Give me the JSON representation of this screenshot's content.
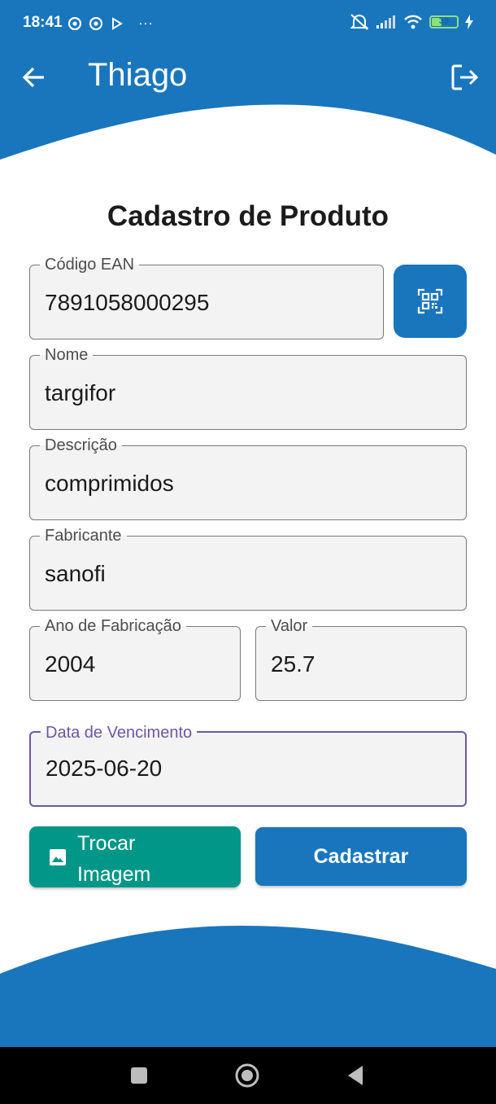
{
  "status_bar": {
    "time": "18:41",
    "more_dots": "···",
    "battery_level": "39",
    "left_icons": [
      "chrome-icon",
      "chrome-icon",
      "play-icon"
    ],
    "right_icons": [
      "mute-icon",
      "signal-icon",
      "wifi-icon",
      "battery-icon",
      "charging-icon"
    ]
  },
  "app_bar": {
    "title": "Thiago",
    "back_icon": "arrow-left-icon",
    "logout_icon": "logout-icon",
    "color": "#1976bd"
  },
  "form": {
    "title": "Cadastro de Produto",
    "ean": {
      "label": "Código EAN",
      "value": "7891058000295"
    },
    "nome": {
      "label": "Nome",
      "value": "targifor"
    },
    "descricao": {
      "label": "Descrição",
      "value": "comprimidos"
    },
    "fabricante": {
      "label": "Fabricante",
      "value": "sanofi"
    },
    "ano": {
      "label": "Ano de Fabricação",
      "value": "2004"
    },
    "valor": {
      "label": "Valor",
      "value": "25.7"
    },
    "vencimento": {
      "label": "Data de Vencimento",
      "value": "2025-06-20"
    },
    "scan_icon": "qr-scan-icon"
  },
  "actions": {
    "trocar_line1": "Trocar",
    "trocar_line2": "Imagem",
    "trocar_icon": "image-icon",
    "cadastrar": "Cadastrar",
    "trocar_color": "#009688",
    "cadastrar_color": "#1976bd"
  },
  "nav_bar": {
    "icons": [
      "square-recents-icon",
      "circle-home-icon",
      "triangle-back-icon"
    ]
  }
}
